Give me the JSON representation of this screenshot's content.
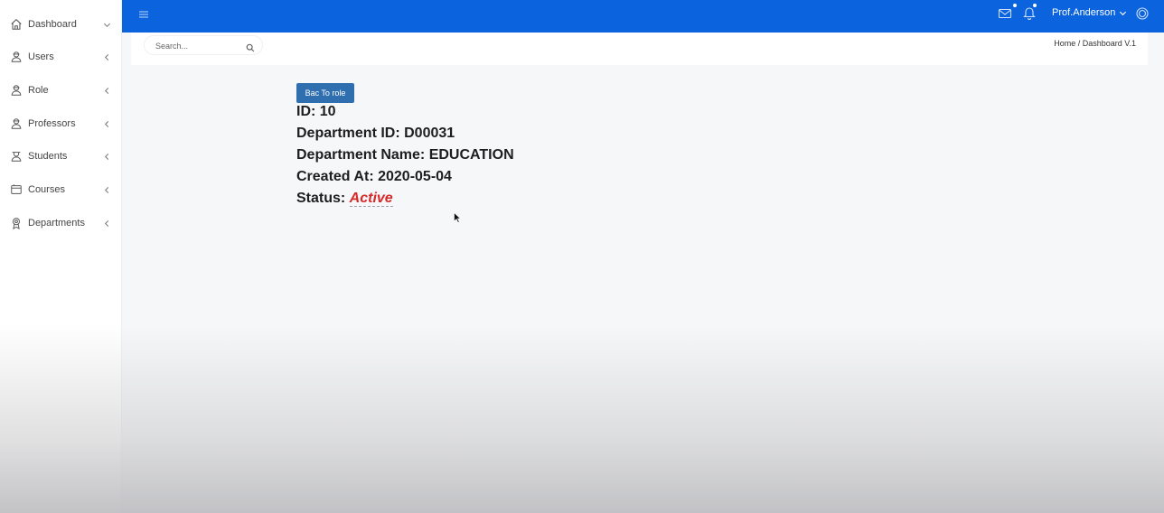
{
  "sidebar": {
    "items": [
      {
        "label": "Dashboard",
        "icon": "home-icon",
        "chevron": "down"
      },
      {
        "label": "Users",
        "icon": "user-icon",
        "chevron": "left"
      },
      {
        "label": "Role",
        "icon": "user-icon",
        "chevron": "left"
      },
      {
        "label": "Professors",
        "icon": "user-icon",
        "chevron": "left"
      },
      {
        "label": "Students",
        "icon": "student-icon",
        "chevron": "left"
      },
      {
        "label": "Courses",
        "icon": "book-icon",
        "chevron": "left"
      },
      {
        "label": "Departments",
        "icon": "award-icon",
        "chevron": "left"
      }
    ]
  },
  "topbar": {
    "user_name": "Prof.Anderson",
    "icons": [
      "menu-icon",
      "mail-icon",
      "bell-icon",
      "settings-icon"
    ],
    "color": "#0b63de"
  },
  "search": {
    "placeholder": "Search..."
  },
  "breadcrumb": {
    "home": "Home",
    "separator": " / ",
    "current": "Dashboard V.1"
  },
  "detail": {
    "back_label": "Bac To role",
    "id_label": "ID: ",
    "id_value": "10",
    "dept_id_label": "Department ID: ",
    "dept_id_value": "D00031",
    "dept_name_label": "Department Name: ",
    "dept_name_value": "EDUCATION",
    "created_label": "Created At: ",
    "created_value": "2020-05-04",
    "status_label": "Status: ",
    "status_value": "Active",
    "status_color": "#d42a2a"
  }
}
